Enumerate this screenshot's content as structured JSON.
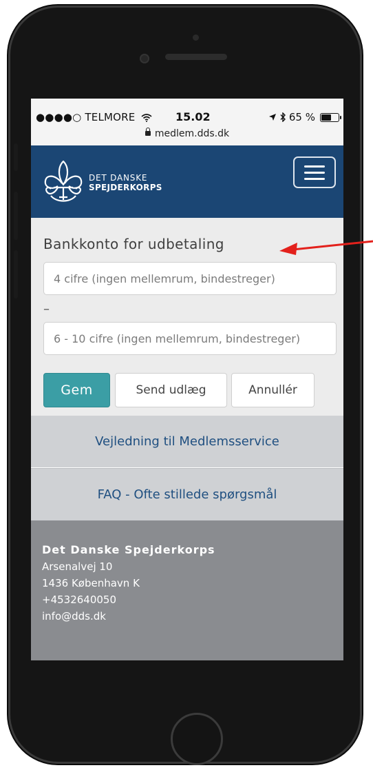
{
  "status_bar": {
    "carrier": "●●●●○ TELMORE",
    "time": "15.02",
    "battery": "65 %",
    "battery_level": 0.65,
    "url": "medlem.dds.dk"
  },
  "navbar": {
    "brand_line1": "DET DANSKE",
    "brand_line2": "SPEJDERKORPS",
    "menu_icon": "hamburger-icon",
    "bg_color": "#1b4674"
  },
  "form": {
    "heading": "Bankkonto for udbetaling",
    "reg_placeholder": "4 cifre (ingen mellemrum, bindestreger)",
    "separator": "–",
    "account_placeholder": "6 - 10 cifre (ingen mellemrum, bindestreger)",
    "save_label": "Gem",
    "send_label": "Send udlæg",
    "cancel_label": "Annullér",
    "accent_color": "#3b9ea5"
  },
  "links": {
    "guide": "Vejledning til Medlemsservice",
    "faq": "FAQ - Ofte stillede spørgsmål"
  },
  "footer": {
    "org_name": "Det Danske Spejderkorps",
    "address": "Arsenalvej 10",
    "city": "1436 København K",
    "phone": "+4532640050",
    "email": "info@dds.dk"
  },
  "annotation": {
    "arrow_color": "#e3211c"
  }
}
